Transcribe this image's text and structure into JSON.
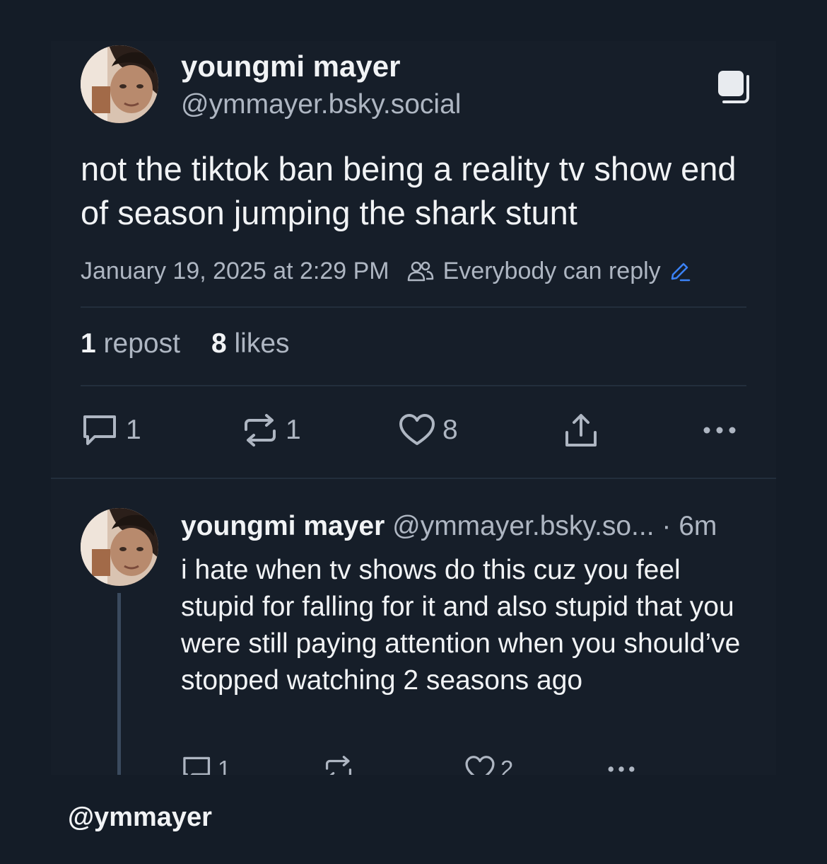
{
  "post": {
    "author_name": "youngmi mayer",
    "author_handle": "@ymmayer.bsky.social",
    "text": "not the tiktok ban being a reality tv show end of season jumping the shark stunt",
    "timestamp": "January 19, 2025 at 2:29 PM",
    "reply_setting": "Everybody can reply",
    "reposts_count": "1",
    "reposts_label": "repost",
    "likes_count": "8",
    "likes_label": "likes",
    "actions": {
      "reply_count": "1",
      "repost_count": "1",
      "like_count": "8"
    }
  },
  "reply": {
    "author_name": "youngmi mayer",
    "author_handle": "@ymmayer.bsky.so...",
    "time_ago": "· 6m",
    "text": "i hate when tv shows do this cuz you feel stupid for falling for it and also stupid that you were still paying attention when you should’ve stopped watching 2 seasons ago",
    "actions": {
      "reply_count": "1",
      "like_count": "2"
    }
  },
  "watermark": "@ymmayer",
  "colors": {
    "background": "#141c27",
    "card": "#161e29",
    "text_primary": "#f1f3f5",
    "text_secondary": "#aeb6c2",
    "accent": "#3b82f6",
    "divider": "#232e3c"
  },
  "icons": [
    "thread-copy-icon",
    "people-icon",
    "pencil-icon",
    "reply-icon",
    "repost-icon",
    "heart-icon",
    "share-icon",
    "more-icon"
  ]
}
